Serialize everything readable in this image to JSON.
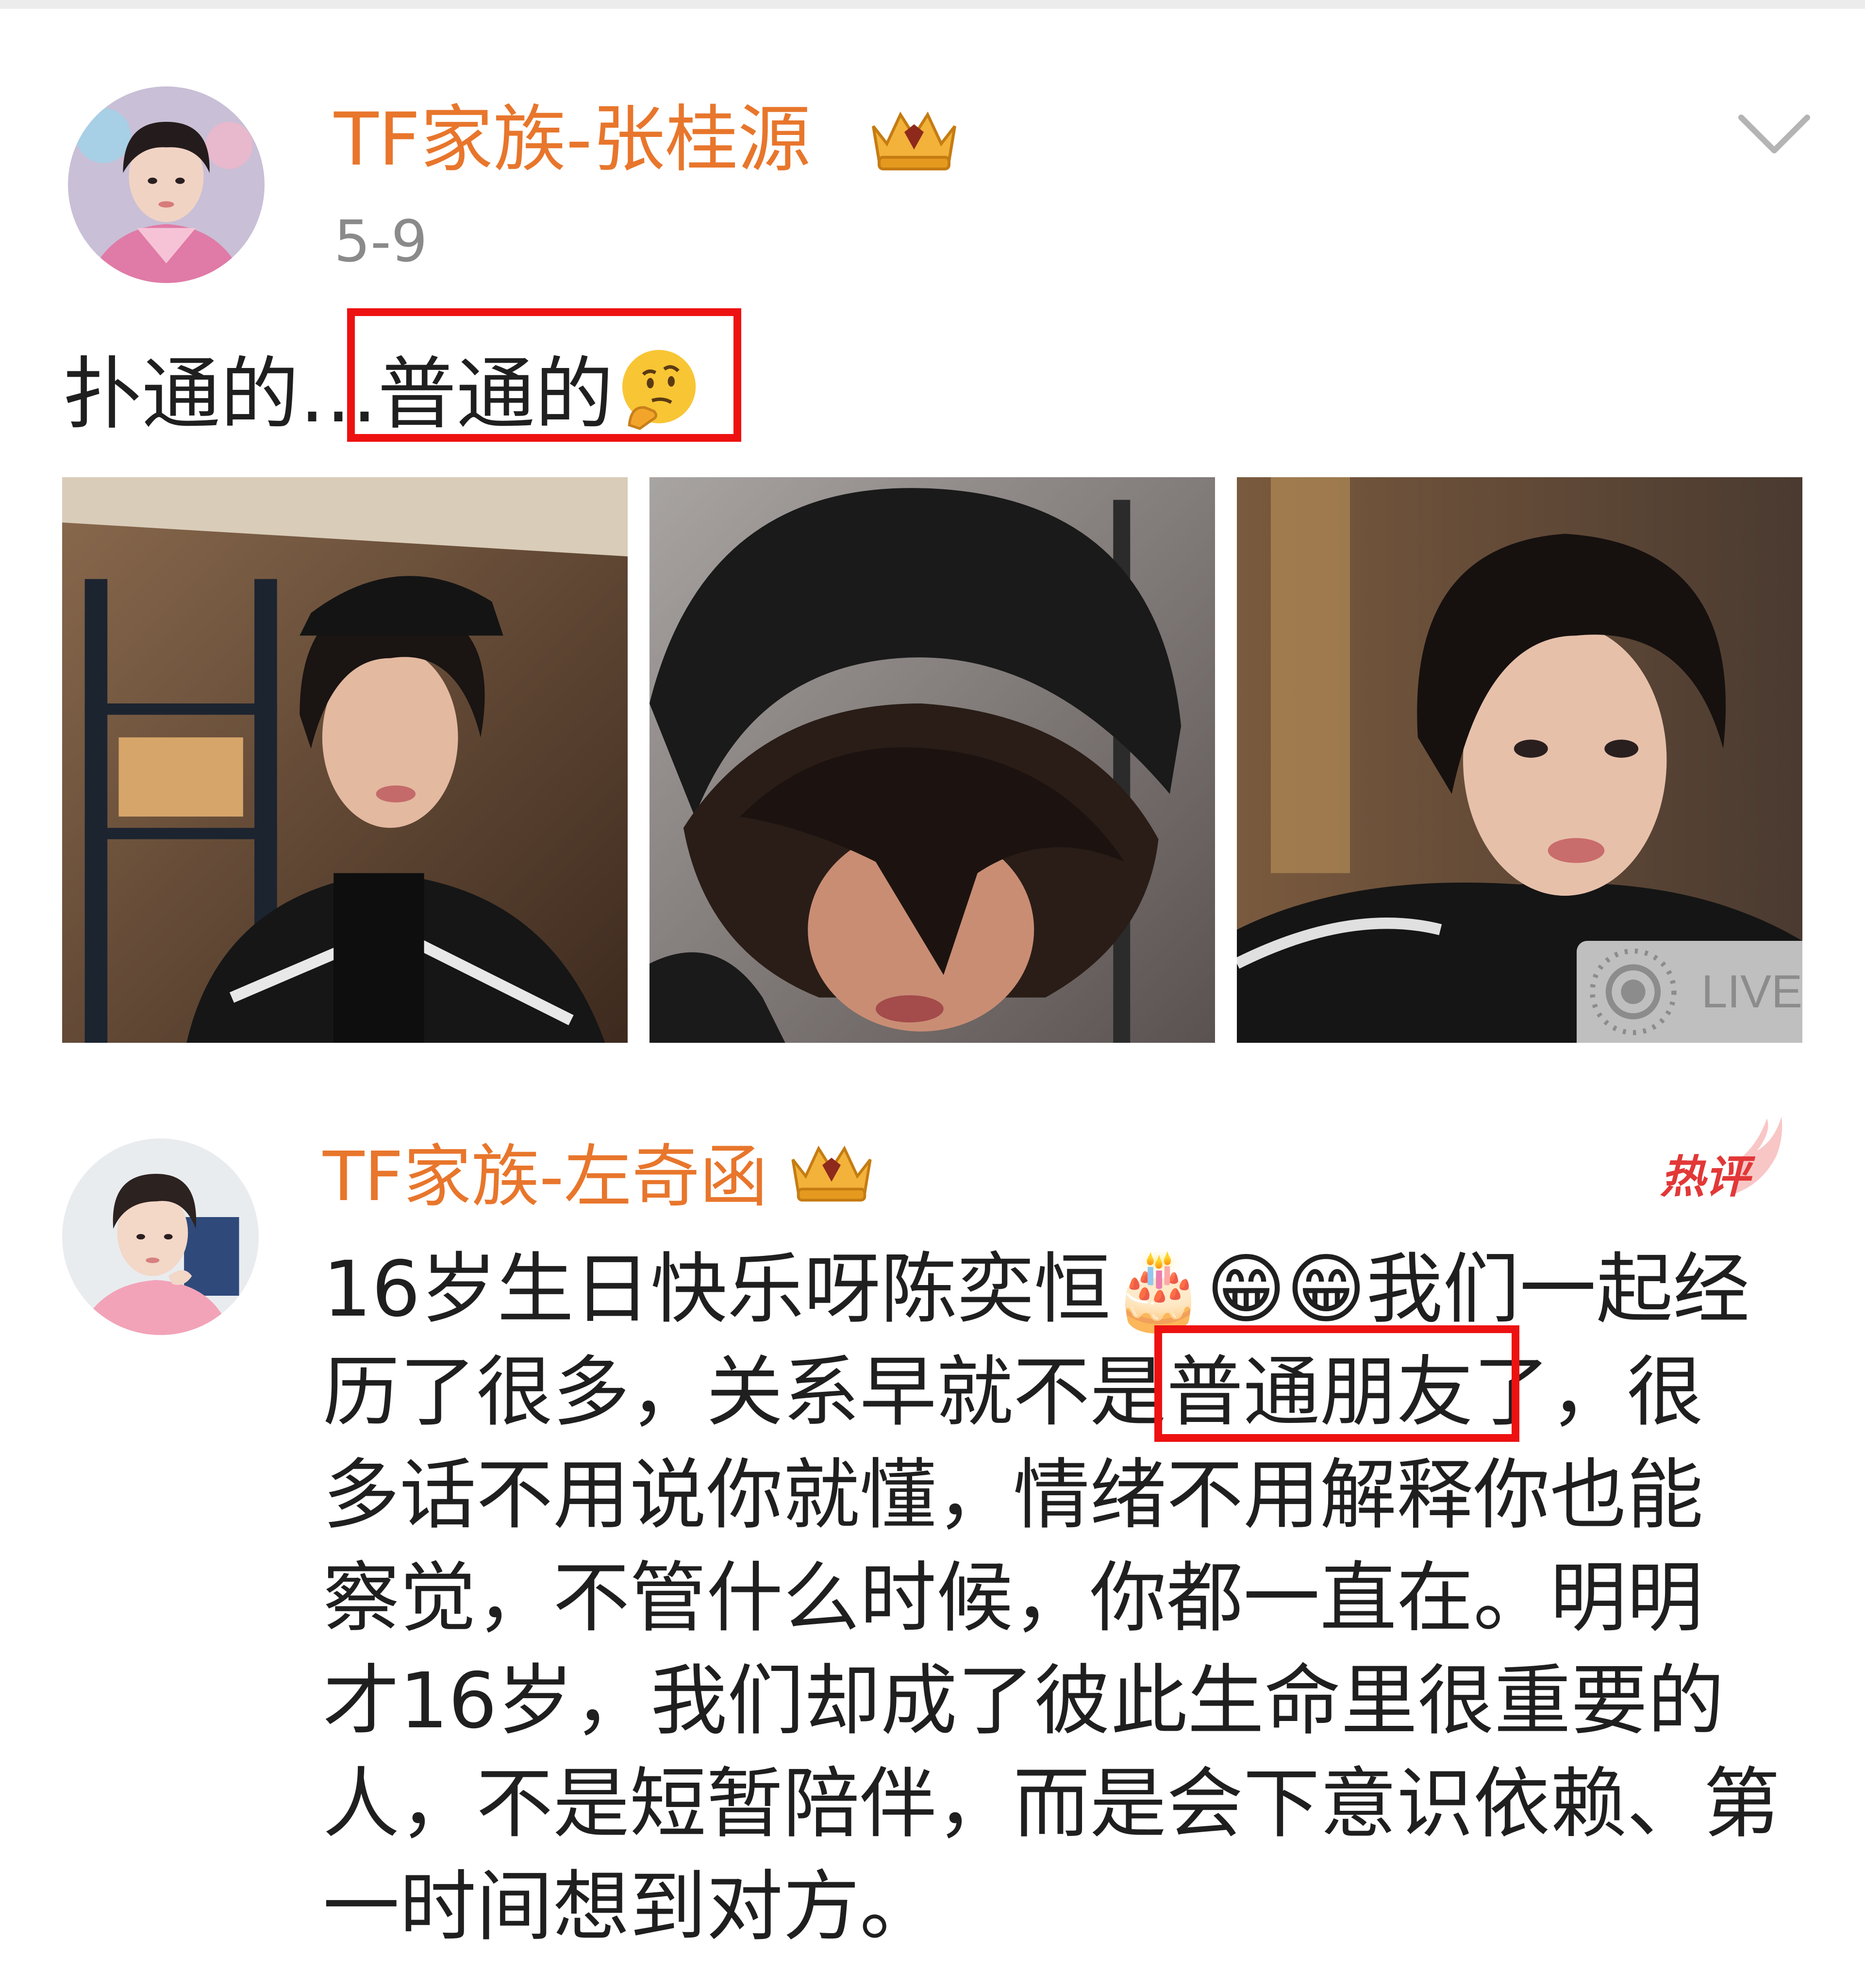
{
  "post": {
    "author": "TF家族-张桂源",
    "date": "5-9",
    "text_prefix": "扑通的…",
    "text_highlight": "普通的",
    "emoji": "thinking-face-emoji",
    "photos": [
      "photo-1",
      "photo-2",
      "photo-3"
    ],
    "live_label": "LIVE"
  },
  "comment": {
    "author": "TF家族-左奇函",
    "hot_label": "热评",
    "lines": [
      "16岁生日快乐呀陈奕恒🎂😁😁我们一起经",
      "历了很多，关系早就不是普通朋友了，很",
      "多话不用说你就懂，情绪不用解释你也能",
      "察觉，不管什么时候，你都一直在。明明",
      "才16岁，我们却成了彼此生命里很重要的",
      "人，不是短暂陪伴，而是会下意识依赖、第",
      "一时间想到对方。"
    ]
  },
  "colors": {
    "username": "#e8762c",
    "highlight_box": "#ee1111",
    "hot": "#e23838"
  }
}
